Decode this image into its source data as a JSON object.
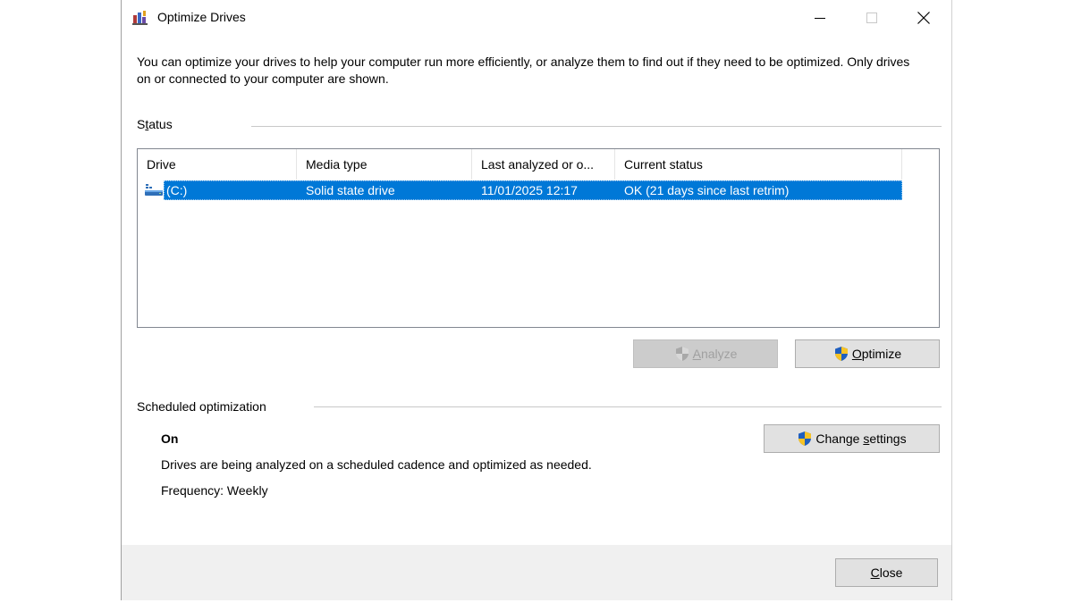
{
  "window": {
    "title": "Optimize Drives",
    "minimize_icon": "minimize-icon",
    "maximize_icon": "maximize-icon",
    "close_icon": "close-icon"
  },
  "intro": "You can optimize your drives to help your computer run more efficiently, or analyze them to find out if they need to be optimized. Only drives on or connected to your computer are shown.",
  "status": {
    "label_pre": "S",
    "label_accel": "t",
    "label_post": "atus",
    "columns": [
      "Drive",
      "Media type",
      "Last analyzed or o...",
      "Current status"
    ],
    "rows": [
      {
        "drive": "(C:)",
        "media_type": "Solid state drive",
        "last_analyzed": "11/01/2025 12:17",
        "current_status": "OK (21 days since last retrim)",
        "selected": true,
        "icon": "drive-icon"
      }
    ]
  },
  "buttons": {
    "analyze_accel": "A",
    "analyze_rest": "nalyze",
    "optimize_accel": "O",
    "optimize_rest": "ptimize",
    "change_pre": "Change ",
    "change_accel": "s",
    "change_rest": "ettings",
    "close_accel": "C",
    "close_rest": "lose"
  },
  "scheduled": {
    "label": "Scheduled optimization",
    "status": "On",
    "description": "Drives are being analyzed on a scheduled cadence and optimized as needed.",
    "frequency": "Frequency: Weekly"
  },
  "colors": {
    "selection": "#0078d7",
    "shield_blue": "#1f5fbf",
    "shield_yellow": "#f7c325"
  }
}
